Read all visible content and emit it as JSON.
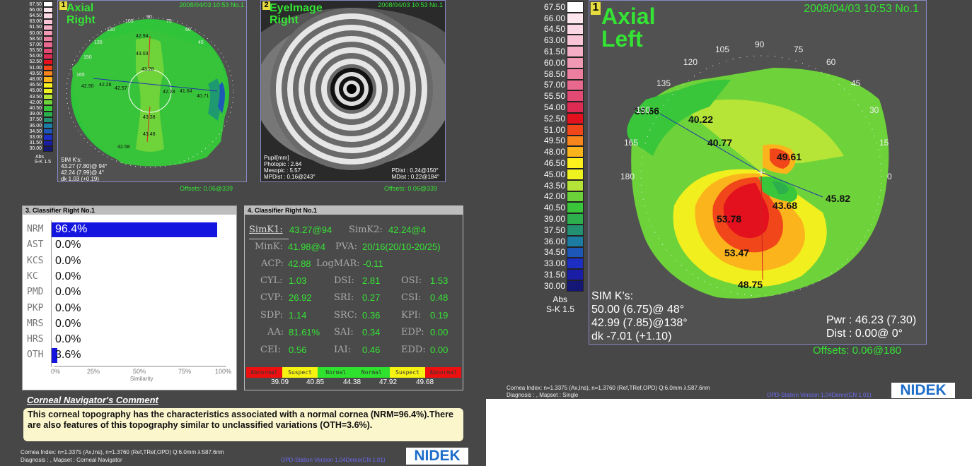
{
  "scale_values": [
    "67.50",
    "66.00",
    "64.50",
    "63.00",
    "61.50",
    "60.00",
    "58.50",
    "57.00",
    "55.50",
    "54.00",
    "52.50",
    "51.00",
    "49.50",
    "48.00",
    "46.50",
    "45.00",
    "43.50",
    "42.00",
    "40.50",
    "39.00",
    "37.50",
    "36.00",
    "34.50",
    "33.00",
    "31.50",
    "30.00"
  ],
  "scale_colors": [
    "#ffffff",
    "#fde6ee",
    "#fbd6e4",
    "#f8c4d6",
    "#f4afc6",
    "#f099b4",
    "#ec7fa0",
    "#e8688e",
    "#e24a74",
    "#dd2b54",
    "#e3101e",
    "#f1461a",
    "#f7851c",
    "#fbb41c",
    "#fdf01d",
    "#eef21f",
    "#b4e437",
    "#6cd23a",
    "#3ac63b",
    "#2caf4c",
    "#239071",
    "#1c7ca2",
    "#1d57b8",
    "#1d2ec3",
    "#1a1da6",
    "#141775"
  ],
  "scale_footer": {
    "abs": "Abs",
    "sk": "S-K 1.5"
  },
  "map1": {
    "num": "1",
    "line1": "Axial",
    "line2": "Right",
    "date": "2008/04/03 10:53 No.1",
    "offsets": "Offsets: 0.06@339",
    "sim": [
      "SIM K's:",
      "43.27 (7.80)@ 94°",
      "42.24 (7.99)@  4°",
      "dk 1.03 (+0.19)"
    ],
    "values": [
      "42.94",
      "43.03",
      "43.28",
      "42.26",
      "42.57",
      "42.28",
      "41.64",
      "40.71",
      "42.90",
      "43.38",
      "43.48",
      "42.58"
    ],
    "angles": [
      "90",
      "105",
      "75",
      "120",
      "60",
      "135",
      "45",
      "150",
      "165"
    ]
  },
  "map2": {
    "num": "2",
    "line1": "EyeImage",
    "line2": "Right",
    "date": "2008/04/03 10:53 No.1",
    "offsets": "Offsets: 0.06@339",
    "pupil": [
      "Pupil[mm]",
      "Photopic : 2.64",
      "Mesopic : 5.57",
      "MPDist : 0.16@243°"
    ],
    "pdist": [
      "PDist : 0.24@150°",
      "MDist : 0.22@184°"
    ]
  },
  "classifier": {
    "title": "3. Classifier  Right  No.1",
    "rows": [
      {
        "code": "NRM",
        "pct": "96.4%",
        "frac": 0.964
      },
      {
        "code": "AST",
        "pct": "0.0%",
        "frac": 0
      },
      {
        "code": "KCS",
        "pct": "0.0%",
        "frac": 0
      },
      {
        "code": "KC",
        "pct": "0.0%",
        "frac": 0
      },
      {
        "code": "PMD",
        "pct": "0.0%",
        "frac": 0
      },
      {
        "code": "PKP",
        "pct": "0.0%",
        "frac": 0
      },
      {
        "code": "MRS",
        "pct": "0.0%",
        "frac": 0
      },
      {
        "code": "HRS",
        "pct": "0.0%",
        "frac": 0
      },
      {
        "code": "OTH",
        "pct": "3.6%",
        "frac": 0.036
      }
    ],
    "axis": [
      "0%",
      "25%",
      "50%",
      "75%",
      "100%"
    ],
    "axis_label": "Similarity"
  },
  "indices": {
    "title": "4. Classifier  Right  No.1",
    "simk1_label": "SimK1:",
    "simk1": "43.27@94",
    "simk2_label": "SimK2:",
    "simk2": "42.24@4",
    "mink_label": "MinK:",
    "mink": "41.98@4",
    "pva_label": "PVA:",
    "pva": "20/16(20/10-20/25)",
    "acp_label": "ACP:",
    "acp": "42.88",
    "logmar_label": "LogMAR:",
    "logmar": "-0.11",
    "grid": [
      [
        "CYL:",
        "1.03",
        "DSI:",
        "2.81",
        "OSI:",
        "1.53"
      ],
      [
        "CVP:",
        "26.92",
        "SRI:",
        "0.27",
        "CSI:",
        "0.48"
      ],
      [
        "SDP:",
        "1.14",
        "SRC:",
        "0.36",
        "KPI:",
        "0.19"
      ],
      [
        "AA:",
        "81.61%",
        "SAI:",
        "0.34",
        "EDP:",
        "0.00"
      ],
      [
        "CEI:",
        "0.56",
        "IAI:",
        "0.46",
        "EDD:",
        "0.00"
      ]
    ],
    "legend": [
      {
        "t": "Abnormal",
        "c": "#ee1010"
      },
      {
        "t": "Suspect",
        "c": "#f6f212"
      },
      {
        "t": "Normal",
        "c": "#2ee22e"
      },
      {
        "t": "Normal",
        "c": "#2ee22e"
      },
      {
        "t": "Suspect",
        "c": "#f6f212"
      },
      {
        "t": "Abnormal",
        "c": "#ee1010"
      }
    ],
    "legend_vals": [
      "39.09",
      "40.85",
      "44.38",
      "47.92",
      "49.68"
    ]
  },
  "comment": {
    "header": "Corneal Navigator's Comment",
    "text": "This corneal topography has the characteristics associated with a normal cornea (NRM=96.4%).There are also features of this topography similar to unclassified variations (OTH=3.6%)."
  },
  "footer_left": {
    "line1": "Cornea Index: n=1.3375 (Ax,Ins), n=1.3760 (Ref,TRef,OPD)  Q:6.0mm  λ:587.6nm",
    "line2": "Diagnosis : , Mapset : Corneal Navigator",
    "version": "OPD-Station Version 1.04Demo(CN 1.01)",
    "brand": "NIDEK"
  },
  "map3": {
    "num": "1",
    "line1": "Axial",
    "line2": "Left",
    "date": "2008/04/03 10:53 No.1",
    "offsets": "Offsets: 0.06@180",
    "sim": [
      "SIM K's:",
      "50.00 (6.75)@ 48°",
      "42.99 (7.85)@138°",
      "dk -7.01 (+1.10)"
    ],
    "pwr": "Pwr :  46.23 (7.30)",
    "dist": "Dist :  0.00@  0°",
    "values": [
      "39.66",
      "40.22",
      "40.77",
      "49.61",
      "45.82",
      "43.68",
      "53.78",
      "53.47",
      "48.75"
    ],
    "angles": [
      "90",
      "105",
      "75",
      "120",
      "60",
      "135",
      "45",
      "150",
      "30",
      "165",
      "15",
      "180",
      "0"
    ]
  },
  "footer_right": {
    "line1": "Cornea Index: n=1.3375 (Ax,Ins), n=1.3760 (Ref,TRef,OPD)  Q:6.0mm  λ:587.6nm",
    "line2": "Diagnosis : , Mapset : Single",
    "version": "OPD-Station Version 1.04Demo(CN 1.01)",
    "brand": "NIDEK"
  }
}
